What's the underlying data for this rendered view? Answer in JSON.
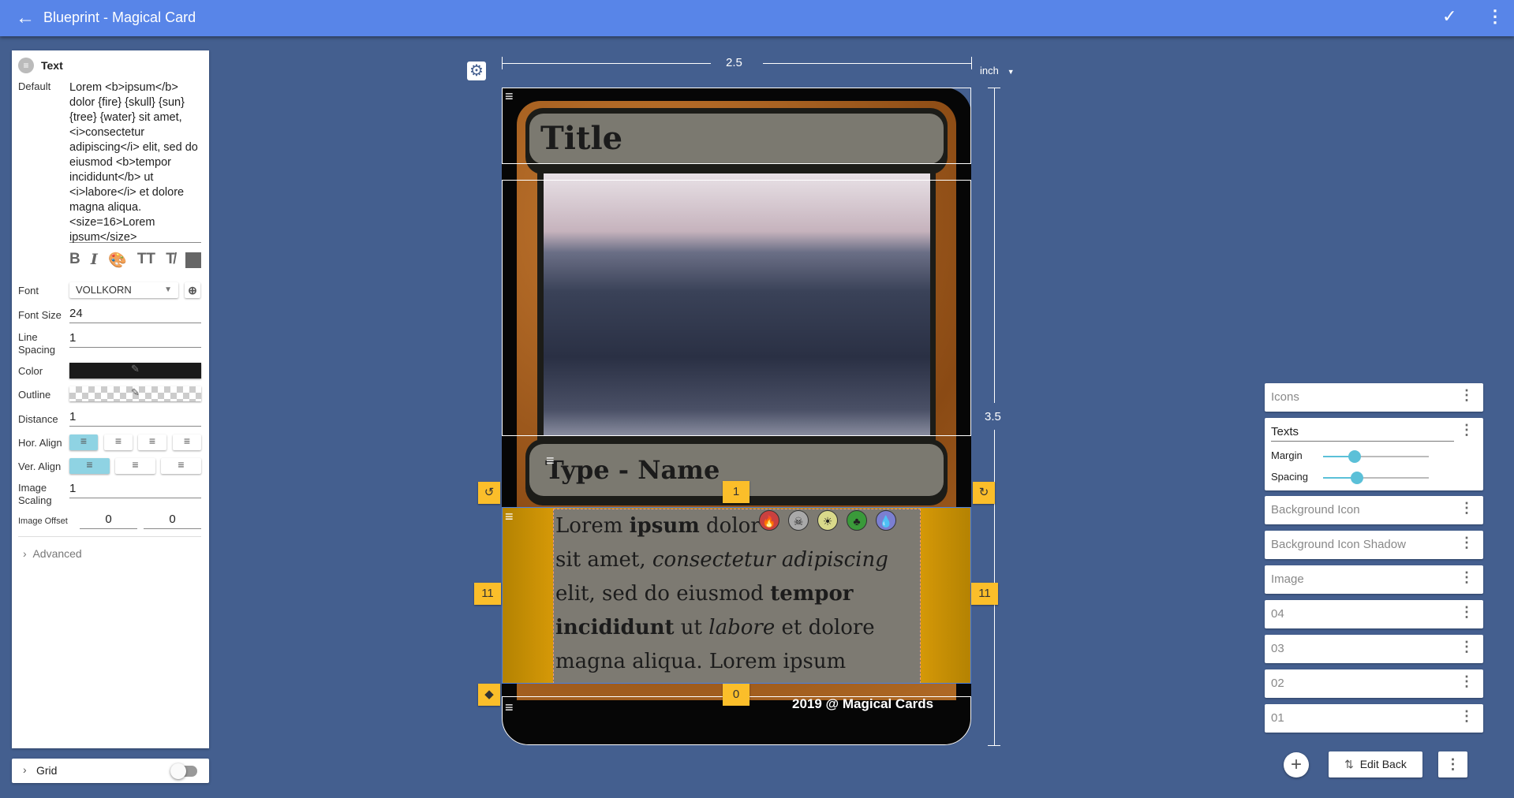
{
  "app": {
    "title": "Blueprint - Magical Card"
  },
  "left_panel": {
    "section_title": "Text",
    "default_label": "Default",
    "default_value": "Lorem <b>ipsum</b> dolor {fire} {skull} {sun} {tree} {water} sit amet, <i>consectetur adipiscing</i> elit, sed do eiusmod <b>tempor incididunt</b> ut <i>labore</i> et dolore magna aliqua. <size=16>Lorem ipsum</size>",
    "font_label": "Font",
    "font_value": "VOLLKORN",
    "font_size_label": "Font Size",
    "font_size_value": "24",
    "line_spacing_label": "Line Spacing",
    "line_spacing_value": "1",
    "color_label": "Color",
    "color_value": "#1a1a1a",
    "outline_label": "Outline",
    "distance_label": "Distance",
    "distance_value": "1",
    "hor_align_label": "Hor. Align",
    "hor_align_selected": "left",
    "ver_align_label": "Ver. Align",
    "ver_align_selected": "top",
    "image_scaling_label": "Image Scaling",
    "image_scaling_value": "1",
    "image_offset_label": "Image Offset",
    "image_offset_x": "0",
    "image_offset_y": "0",
    "advanced_label": "Advanced"
  },
  "grid": {
    "label": "Grid",
    "enabled": false
  },
  "canvas": {
    "width_value": "2.5",
    "height_value": "3.5",
    "unit": "inch",
    "card": {
      "title": "Title",
      "type_line": "Type - Name",
      "body_lines": [
        [
          {
            "t": "Lorem "
          },
          {
            "t": "ipsum",
            "b": true
          },
          {
            "t": " dolor"
          }
        ],
        [
          {
            "t": "sit amet, "
          },
          {
            "t": "consectetur adipiscing",
            "i": true
          }
        ],
        [
          {
            "t": "elit, sed do eiusmod "
          },
          {
            "t": "tempor",
            "b": true
          }
        ],
        [
          {
            "t": "incididunt",
            "b": true
          },
          {
            "t": " ut "
          },
          {
            "t": "labore",
            "i": true
          },
          {
            "t": " et dolore"
          }
        ],
        [
          {
            "t": "magna aliqua. Lorem ipsum"
          }
        ]
      ],
      "mana_icons": [
        {
          "name": "fire",
          "color": "#c9413f"
        },
        {
          "name": "skull",
          "color": "#a9a9a9"
        },
        {
          "name": "sun",
          "color": "#d9d98a"
        },
        {
          "name": "tree",
          "color": "#3a9a3a"
        },
        {
          "name": "water",
          "color": "#7b7fd1"
        }
      ],
      "footer": "2019 @ Magical Cards"
    },
    "handles": {
      "top_margin": "1",
      "left_margin": "11",
      "right_margin": "11",
      "bottom_margin": "0"
    }
  },
  "layers": {
    "items": [
      "Icons",
      "Texts",
      "Background Icon",
      "Background Icon Shadow",
      "Image",
      "04",
      "03",
      "02",
      "01"
    ],
    "texts_margin_label": "Margin",
    "texts_margin_value": 0.3,
    "texts_spacing_label": "Spacing",
    "texts_spacing_value": 0.32
  },
  "bottom": {
    "edit_back_label": "Edit Back"
  },
  "colors": {
    "topbar": "#5885e8",
    "background": "#445f8f",
    "accent": "#5bc0d8",
    "handle": "#fbbe2a"
  }
}
